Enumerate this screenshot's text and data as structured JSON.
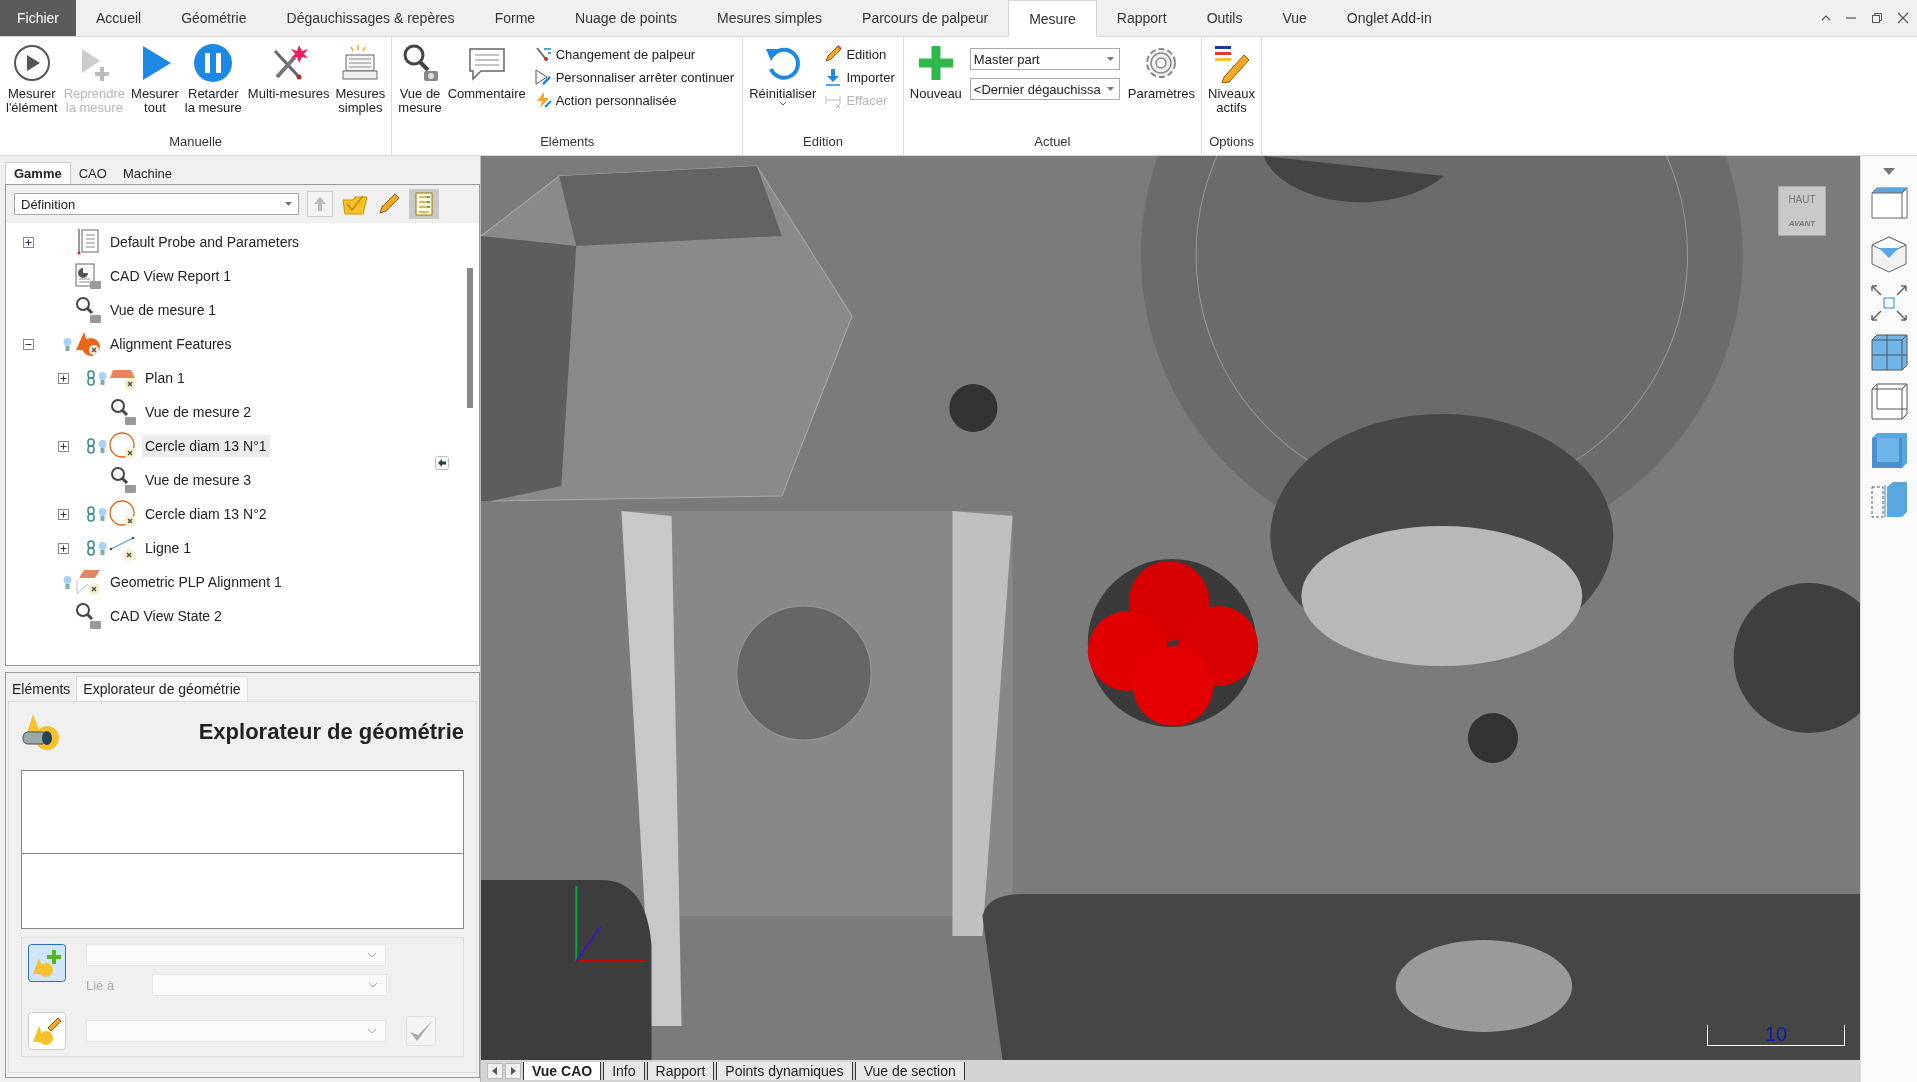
{
  "ribbon": {
    "tabs": [
      {
        "label": "Fichier",
        "selected": false,
        "kind": "file"
      },
      {
        "label": "Accueil",
        "selected": false,
        "kind": "tab"
      },
      {
        "label": "Géométrie",
        "selected": false,
        "kind": "tab"
      },
      {
        "label": "Dégauchissages & repères",
        "selected": false,
        "kind": "tab"
      },
      {
        "label": "Forme",
        "selected": false,
        "kind": "tab"
      },
      {
        "label": "Nuage de points",
        "selected": false,
        "kind": "tab"
      },
      {
        "label": "Mesures simples",
        "selected": false,
        "kind": "tab"
      },
      {
        "label": "Parcours de palpeur",
        "selected": false,
        "kind": "tab"
      },
      {
        "label": "Mesure",
        "selected": true,
        "kind": "tab"
      },
      {
        "label": "Rapport",
        "selected": false,
        "kind": "tab"
      },
      {
        "label": "Outils",
        "selected": false,
        "kind": "tab"
      },
      {
        "label": "Vue",
        "selected": false,
        "kind": "tab"
      },
      {
        "label": "Onglet Add-in",
        "selected": false,
        "kind": "tab"
      }
    ],
    "groups": [
      {
        "title": "Manuelle",
        "items": [
          {
            "kind": "large",
            "label": "Mesurer\nl'élément",
            "disabled": false
          },
          {
            "kind": "large",
            "label": "Reprendre\nla mesure",
            "disabled": true
          },
          {
            "kind": "large",
            "label": "Mesurer\ntout",
            "disabled": false
          },
          {
            "kind": "large",
            "label": "Retarder\nla mesure",
            "disabled": false
          },
          {
            "kind": "large",
            "label": "Multi-mesures",
            "disabled": false
          },
          {
            "kind": "large",
            "label": "Mesures\nsimples",
            "disabled": false
          }
        ]
      },
      {
        "title": "Eléments",
        "items": [
          {
            "kind": "large",
            "label": "Vue de\nmesure",
            "disabled": false
          },
          {
            "kind": "large",
            "label": "Commentaire",
            "disabled": false
          },
          {
            "kind": "small",
            "label": "Changement de palpeur",
            "disabled": false
          },
          {
            "kind": "small",
            "label": "Personnaliser arrêter continuer",
            "disabled": false
          },
          {
            "kind": "small",
            "label": "Action personnalisée",
            "disabled": false
          }
        ]
      },
      {
        "title": "Edition",
        "items": [
          {
            "kind": "split",
            "label": "Réinitialiser",
            "disabled": false
          },
          {
            "kind": "small",
            "label": "Edition",
            "disabled": false
          },
          {
            "kind": "small",
            "label": "Importer",
            "disabled": false
          },
          {
            "kind": "small",
            "label": "Effacer",
            "disabled": true
          }
        ]
      },
      {
        "title": "Actuel",
        "items": [
          {
            "kind": "large",
            "label": "Nouveau",
            "disabled": false
          },
          {
            "kind": "combo",
            "value": "Master part"
          },
          {
            "kind": "combo",
            "value": "<Dernier dégauchissa"
          },
          {
            "kind": "large",
            "label": "Paramètres",
            "disabled": false
          }
        ]
      },
      {
        "title": "Options",
        "items": [
          {
            "kind": "large",
            "label": "Niveaux\nactifs",
            "disabled": false
          }
        ]
      }
    ]
  },
  "left_panel": {
    "tabs": [
      {
        "label": "Gamme",
        "selected": true
      },
      {
        "label": "CAO",
        "selected": false
      },
      {
        "label": "Machine",
        "selected": false
      }
    ],
    "view_selector": {
      "value": "Définition"
    },
    "tree": {
      "items": [
        {
          "label": "Default Probe and Parameters",
          "kind": "settings",
          "expanded": false,
          "selected": false
        },
        {
          "label": "CAD View Report 1",
          "kind": "report",
          "selected": false
        },
        {
          "label": "Vue de mesure 1",
          "kind": "view",
          "selected": false
        },
        {
          "label": "Alignment Features",
          "kind": "group",
          "expanded": true,
          "selected": false,
          "children": [
            {
              "label": "Plan 1",
              "kind": "plane",
              "expanded": false,
              "selected": false
            },
            {
              "label": "Vue de mesure 2",
              "kind": "view",
              "selected": false
            },
            {
              "label": "Cercle diam 13 N°1",
              "kind": "circle",
              "expanded": false,
              "selected": true
            },
            {
              "label": "Vue de mesure 3",
              "kind": "view",
              "selected": false
            },
            {
              "label": "Cercle diam 13 N°2",
              "kind": "circle",
              "expanded": false,
              "selected": false
            },
            {
              "label": "Ligne 1",
              "kind": "line",
              "expanded": false,
              "selected": false
            }
          ]
        },
        {
          "label": "Geometric PLP Alignment 1",
          "kind": "alignment",
          "selected": false
        },
        {
          "label": "CAD View State 2",
          "kind": "view",
          "selected": false
        }
      ]
    }
  },
  "geometry_panel": {
    "tabs": [
      {
        "label": "Eléments",
        "selected": false
      },
      {
        "label": "Explorateur de géométrie",
        "selected": true
      }
    ],
    "title": "Explorateur de géométrie",
    "linked_label": "Lié à"
  },
  "viewport": {
    "nav_cube": {
      "top": "HAUT",
      "front": "AVANT"
    },
    "scale": "10",
    "tabs": [
      {
        "label": "Vue CAO",
        "selected": true
      },
      {
        "label": "Info",
        "selected": false
      },
      {
        "label": "Rapport",
        "selected": false
      },
      {
        "label": "Points dynamiques",
        "selected": false
      },
      {
        "label": "Vue de section",
        "selected": false
      }
    ]
  }
}
